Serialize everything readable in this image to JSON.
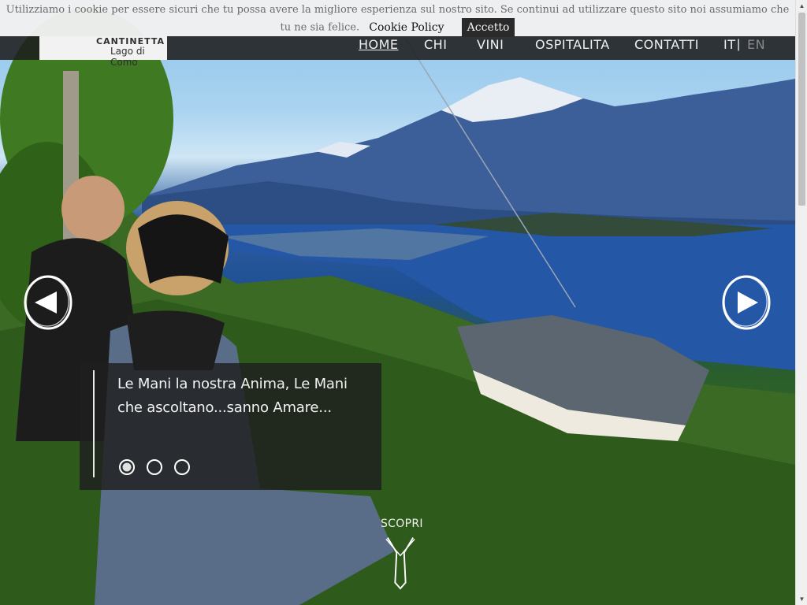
{
  "cookie": {
    "message": "Utilizziamo i cookie per essere sicuri che tu possa avere la migliore esperienza sul nostro sito. Se continui ad utilizzare questo sito noi assumiamo che tu ne sia felice.",
    "policy_label": "Cookie Policy",
    "accept_label": "Accetto"
  },
  "logo": {
    "line1": "CANTINETTA",
    "line2": "Lago di Como"
  },
  "nav": {
    "items": [
      {
        "label": "HOME",
        "active": true
      },
      {
        "label": "CHI"
      },
      {
        "label": "VINI"
      },
      {
        "label": "OSPITALITA"
      },
      {
        "label": "CONTATTI"
      }
    ],
    "lang_it": "IT",
    "lang_sep": "|",
    "lang_en": "EN"
  },
  "slider": {
    "caption": "Le Mani la nostra Anima, Le Mani che ascoltano...sanno Amare...",
    "slide_count": 3,
    "active_slide": 1
  },
  "scopri": {
    "label": "SCOPRI"
  },
  "colors": {
    "nav_bg": "#1e1e1e",
    "cookie_bg": "#f0f0f0",
    "accept_bg": "#2a2a2a",
    "lang_inactive": "#8a8a8a"
  },
  "icons": {
    "prev": "arrow-left-circle-icon",
    "next": "arrow-right-circle-icon",
    "scopri": "arrow-down-icon"
  }
}
